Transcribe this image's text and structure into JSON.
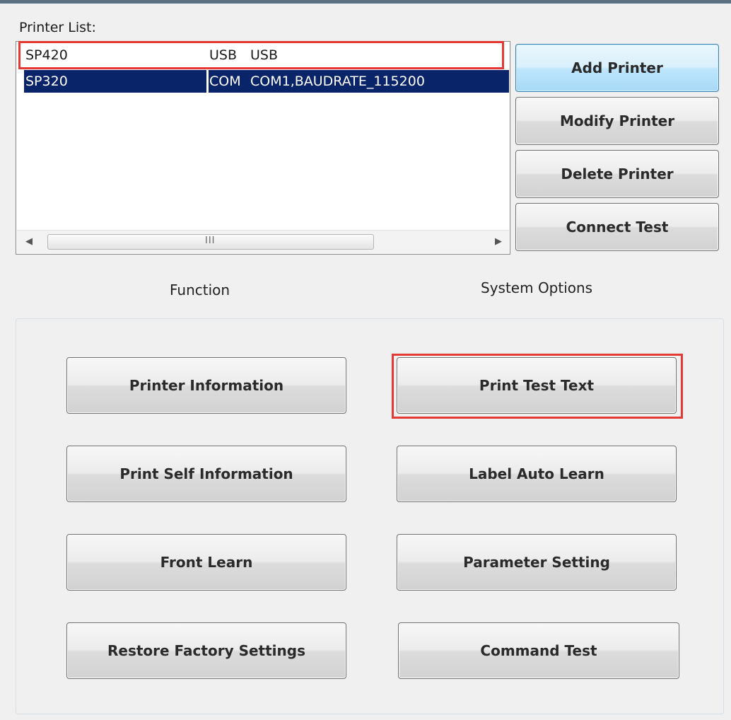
{
  "printer_list": {
    "label": "Printer List:",
    "rows": [
      {
        "name": "SP420",
        "type": "USB",
        "port": "USB"
      },
      {
        "name": "SP320",
        "type": "COM",
        "port": "COM1,BAUDRATE_115200"
      }
    ],
    "scroll_grip": "III"
  },
  "printer_buttons": {
    "add": "Add Printer",
    "modify": "Modify Printer",
    "delete": "Delete Printer",
    "connect": "Connect Test"
  },
  "captions": {
    "function": "Function",
    "system_options": "System Options"
  },
  "function_buttons": {
    "printer_information": "Printer Information",
    "print_self_information": "Print Self Information",
    "front_learn": "Front Learn",
    "restore_factory_settings": "Restore Factory Settings"
  },
  "system_buttons": {
    "print_test_text": "Print Test Text",
    "label_auto_learn": "Label Auto Learn",
    "parameter_setting": "Parameter Setting",
    "command_test": "Command Test"
  },
  "colors": {
    "selection": "#0a246a",
    "highlight_box": "#e53935",
    "accent_button": "#bee6fd"
  }
}
